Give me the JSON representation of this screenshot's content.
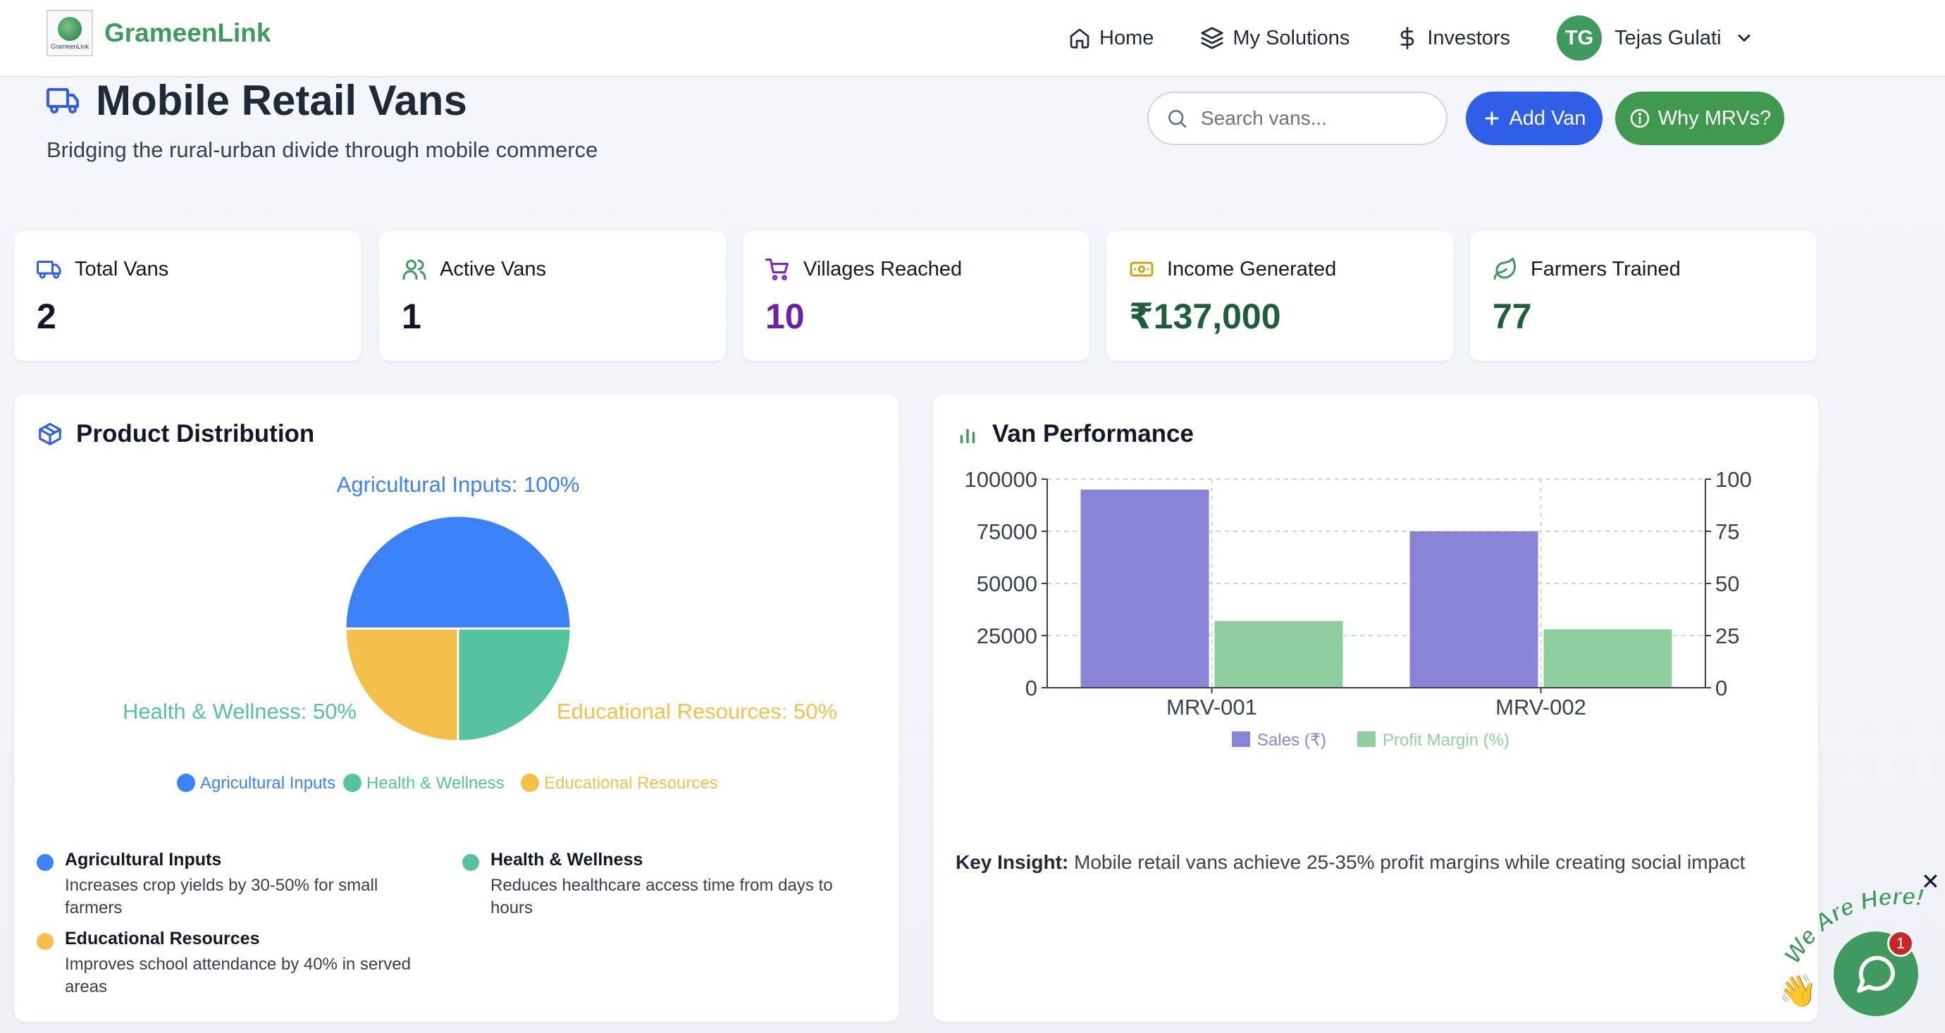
{
  "app": {
    "brand": "GrameenLink",
    "logo_text": "GrameenLink"
  },
  "nav": {
    "home": "Home",
    "solutions": "My Solutions",
    "investors": "Investors",
    "user_initials": "TG",
    "user_name": "Tejas Gulati"
  },
  "header": {
    "title": "Mobile Retail Vans",
    "subtitle": "Bridging the rural-urban divide through mobile commerce",
    "search_placeholder": "Search vans...",
    "add_label": "Add Van",
    "why_label": "Why MRVs?"
  },
  "stats": [
    {
      "label": "Total Vans",
      "value": "2",
      "color": "#111827",
      "icon": "truck-icon"
    },
    {
      "label": "Active Vans",
      "value": "1",
      "color": "#111827",
      "icon": "users-icon"
    },
    {
      "label": "Villages Reached",
      "value": "10",
      "color": "#6b21a8",
      "icon": "cart-icon"
    },
    {
      "label": "Income Generated",
      "value": "₹137,000",
      "color": "#1f5e3b",
      "icon": "banknote-icon"
    },
    {
      "label": "Farmers Trained",
      "value": "77",
      "color": "#1f5e3b",
      "icon": "leaf-icon"
    }
  ],
  "product_panel": {
    "title": "Product Distribution",
    "descriptions": [
      {
        "name": "Agricultural Inputs",
        "text_lines": [
          "Increases crop yields by 30-50% for small",
          "farmers"
        ],
        "color": "#3b82f6"
      },
      {
        "name": "Health & Wellness",
        "text_lines": [
          "Reduces healthcare access time from days to",
          "hours"
        ],
        "color": "#56c2a0"
      },
      {
        "name": "Educational Resources",
        "text_lines": [
          "Improves school attendance by 40% in served",
          "areas"
        ],
        "color": "#f4c04a"
      }
    ]
  },
  "performance_panel": {
    "title": "Van Performance",
    "insight_label": "Key Insight:",
    "insight_text": "Mobile retail vans achieve 25-35% profit margins while creating social impact"
  },
  "chat": {
    "badge": "1",
    "label": "We Are Here!",
    "close": "✕"
  },
  "chart_data": [
    {
      "type": "pie",
      "categories": [
        "Agricultural Inputs",
        "Health & Wellness",
        "Educational Resources"
      ],
      "values": [
        100,
        50,
        50
      ],
      "slice_labels": [
        "Agricultural Inputs: 100%",
        "Health & Wellness: 50%",
        "Educational Resources: 50%"
      ],
      "colors": [
        "#3b82f6",
        "#56c2a0",
        "#f4c04a"
      ],
      "legend": "bottom"
    },
    {
      "type": "bar",
      "categories": [
        "MRV-001",
        "MRV-002"
      ],
      "series": [
        {
          "name": "Sales (₹)",
          "values": [
            95000,
            75000
          ],
          "axis": "left",
          "color": "#8884d8"
        },
        {
          "name": "Profit Margin (%)",
          "values": [
            32,
            28
          ],
          "axis": "right",
          "color": "#8fcf9f"
        }
      ],
      "ylim_left": [
        0,
        100000
      ],
      "yticks_left": [
        "0",
        "25000",
        "50000",
        "75000",
        "100000"
      ],
      "ylim_right": [
        0,
        100
      ],
      "yticks_right": [
        "0",
        "25",
        "50",
        "75",
        "100"
      ],
      "grid": true,
      "legend": "bottom"
    }
  ]
}
